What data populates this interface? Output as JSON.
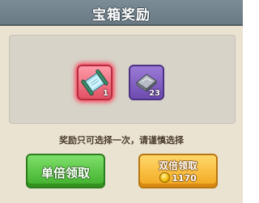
{
  "title": "宝箱奖励",
  "rewards": [
    {
      "icon": "scroll-icon",
      "quantity": "1",
      "rarity_color": "#e25164",
      "selected": true
    },
    {
      "icon": "metal-plate-icon",
      "quantity": "23",
      "rarity_color": "#7a58c0",
      "selected": false
    }
  ],
  "notice": "奖励只可选择一次，请谨慎选择",
  "buttons": {
    "single_label": "单倍领取",
    "double_label": "双倍领取",
    "double_cost": "1170",
    "double_cost_icon": "coin-icon"
  }
}
